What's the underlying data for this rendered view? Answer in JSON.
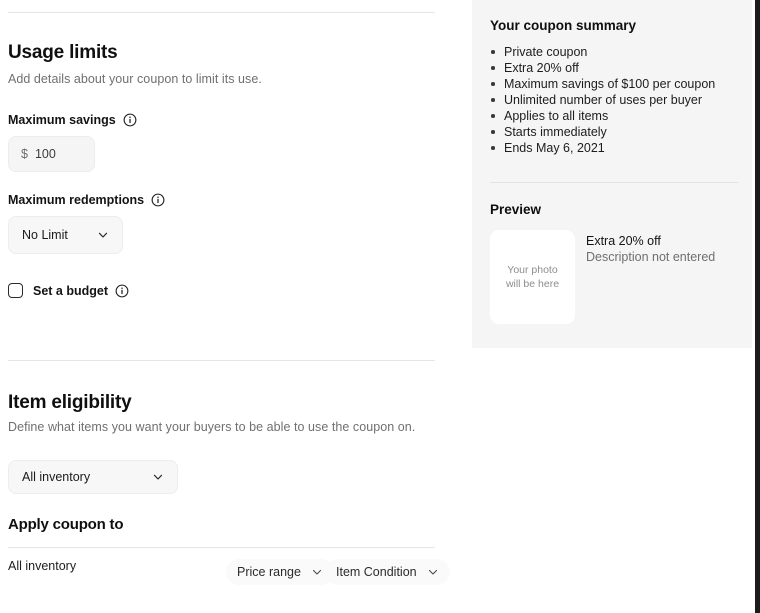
{
  "usage_limits": {
    "title": "Usage limits",
    "subtitle": "Add details about your coupon to limit its use.",
    "max_savings": {
      "label": "Maximum savings",
      "info_icon": "info-icon",
      "currency": "$",
      "value": "100",
      "placeholder": "100"
    },
    "max_redemptions": {
      "label": "Maximum redemptions",
      "info_icon": "info-icon",
      "selected": "No Limit",
      "chevron_icon": "chevron-down-icon"
    },
    "budget": {
      "label": "Set a budget",
      "checked": false,
      "info_icon": "info-icon"
    }
  },
  "item_eligibility": {
    "title": "Item eligibility",
    "subtitle": "Define what items you want your buyers to be able to use the coupon on.",
    "inventory_select": {
      "selected": "All inventory",
      "chevron_icon": "chevron-down-icon"
    }
  },
  "apply_coupon": {
    "title": "Apply coupon to",
    "row_label": "All inventory",
    "filters": [
      {
        "label": "Price range",
        "chevron_icon": "chevron-down-icon"
      },
      {
        "label": "Item Condition",
        "chevron_icon": "chevron-down-icon"
      }
    ]
  },
  "summary": {
    "title": "Your coupon summary",
    "items": [
      "Private coupon",
      "Extra 20% off",
      "Maximum savings of $100 per coupon",
      "Unlimited number of uses per buyer",
      "Applies to all items",
      "Starts immediately",
      "Ends May 6, 2021"
    ],
    "preview": {
      "title": "Preview",
      "photo_placeholder_line1": "Your photo",
      "photo_placeholder_line2": "will be here",
      "heading": "Extra 20% off",
      "description": "Description not entered"
    }
  },
  "colors": {
    "panel_bg": "#f5f5f5",
    "page_bg": "#ffffff",
    "text_primary": "#111111",
    "text_muted": "#707070",
    "divider": "#e6e6e6"
  }
}
